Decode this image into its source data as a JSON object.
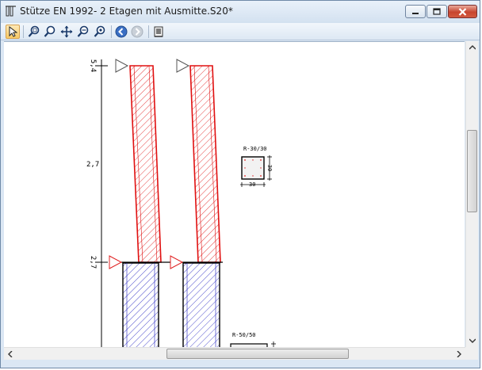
{
  "window": {
    "title": "Stütze EN 1992- 2 Etagen mit Ausmitte.S20*"
  },
  "toolbar": {
    "tools": [
      {
        "name": "pointer",
        "icon": "pointer-icon",
        "active": true
      },
      {
        "name": "zoom-window",
        "icon": "zoom-window-icon"
      },
      {
        "name": "zoom-in",
        "icon": "zoom-in-icon"
      },
      {
        "name": "pan",
        "icon": "pan-icon"
      },
      {
        "name": "zoom-out",
        "icon": "zoom-out-icon"
      },
      {
        "name": "zoom-all",
        "icon": "zoom-all-icon"
      },
      {
        "name": "back",
        "icon": "back-arrow-icon"
      },
      {
        "name": "forward",
        "icon": "forward-arrow-icon",
        "disabled": true
      },
      {
        "name": "print",
        "icon": "print-icon"
      }
    ]
  },
  "drawing": {
    "dim_labels": [
      "5,4",
      "2,7",
      "2,7"
    ],
    "section_1": {
      "label": "R-30/30",
      "width_label": "30",
      "height_label": "30"
    },
    "section_2": {
      "label": "R-50/50"
    },
    "colors": {
      "upper_column": "#e01010",
      "lower_column": "#2020c0",
      "axis": "#000000",
      "support_upper": "#555555",
      "support_lower": "#e02020"
    }
  }
}
